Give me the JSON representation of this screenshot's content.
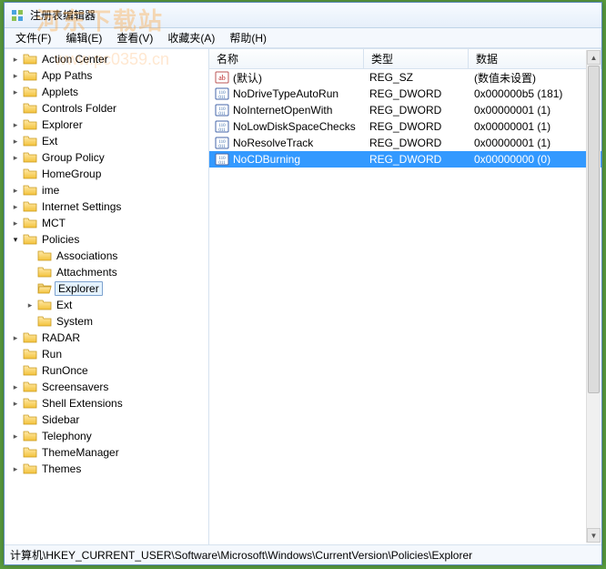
{
  "window": {
    "title": "注册表编辑器"
  },
  "menu": [
    "文件(F)",
    "编辑(E)",
    "查看(V)",
    "收藏夹(A)",
    "帮助(H)"
  ],
  "tree": [
    {
      "label": "Action Center",
      "expander": "closed"
    },
    {
      "label": "App Paths",
      "expander": "closed"
    },
    {
      "label": "Applets",
      "expander": "closed"
    },
    {
      "label": "Controls Folder",
      "expander": ""
    },
    {
      "label": "Explorer",
      "expander": "closed"
    },
    {
      "label": "Ext",
      "expander": "closed"
    },
    {
      "label": "Group Policy",
      "expander": "closed"
    },
    {
      "label": "HomeGroup",
      "expander": ""
    },
    {
      "label": "ime",
      "expander": "closed"
    },
    {
      "label": "Internet Settings",
      "expander": "closed"
    },
    {
      "label": "MCT",
      "expander": "closed"
    },
    {
      "label": "Policies",
      "expander": "open",
      "children": [
        {
          "label": "Associations",
          "expander": ""
        },
        {
          "label": "Attachments",
          "expander": ""
        },
        {
          "label": "Explorer",
          "expander": "",
          "selected": true
        },
        {
          "label": "Ext",
          "expander": "closed"
        },
        {
          "label": "System",
          "expander": ""
        }
      ]
    },
    {
      "label": "RADAR",
      "expander": "closed"
    },
    {
      "label": "Run",
      "expander": ""
    },
    {
      "label": "RunOnce",
      "expander": ""
    },
    {
      "label": "Screensavers",
      "expander": "closed"
    },
    {
      "label": "Shell Extensions",
      "expander": "closed"
    },
    {
      "label": "Sidebar",
      "expander": ""
    },
    {
      "label": "Telephony",
      "expander": "closed"
    },
    {
      "label": "ThemeManager",
      "expander": ""
    },
    {
      "label": "Themes",
      "expander": "closed"
    }
  ],
  "listHeaders": {
    "name": "名称",
    "type": "类型",
    "data": "数据"
  },
  "values": [
    {
      "name": "(默认)",
      "type": "REG_SZ",
      "data": "(数值未设置)",
      "iconVariant": "sz"
    },
    {
      "name": "NoDriveTypeAutoRun",
      "type": "REG_DWORD",
      "data": "0x000000b5 (181)",
      "iconVariant": "bin"
    },
    {
      "name": "NoInternetOpenWith",
      "type": "REG_DWORD",
      "data": "0x00000001 (1)",
      "iconVariant": "bin"
    },
    {
      "name": "NoLowDiskSpaceChecks",
      "type": "REG_DWORD",
      "data": "0x00000001 (1)",
      "iconVariant": "bin"
    },
    {
      "name": "NoResolveTrack",
      "type": "REG_DWORD",
      "data": "0x00000001 (1)",
      "iconVariant": "bin"
    },
    {
      "name": "NoCDBurning",
      "type": "REG_DWORD",
      "data": "0x00000000 (0)",
      "iconVariant": "bin",
      "selected": true
    }
  ],
  "statusPath": "计算机\\HKEY_CURRENT_USER\\Software\\Microsoft\\Windows\\CurrentVersion\\Policies\\Explorer",
  "watermark": {
    "line1": "河东下载站",
    "line2": "www.pc0359.cn"
  }
}
